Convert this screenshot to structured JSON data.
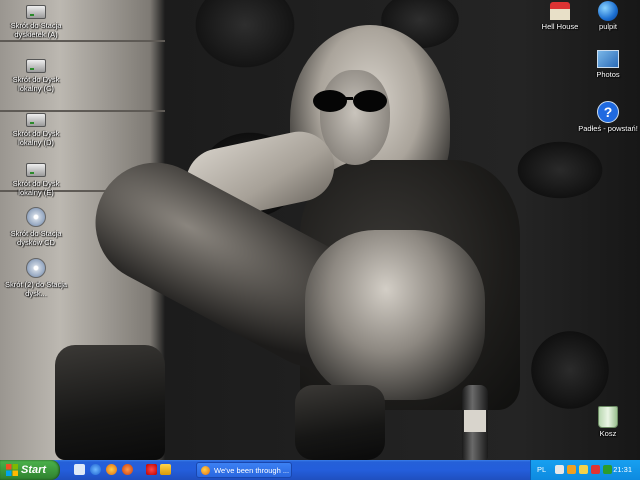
{
  "desktop": {
    "icons_left": [
      {
        "name": "icon-floppy-shortcut",
        "label": "Skrót do Stacja dyskietek (A)",
        "type": "drive"
      },
      {
        "name": "icon-disk-c-shortcut",
        "label": "Skrót do Dysk lokalny (C)",
        "type": "drive"
      },
      {
        "name": "icon-disk-d-shortcut",
        "label": "Skrót do Dysk lokalny (D)",
        "type": "drive"
      },
      {
        "name": "icon-disk-e-shortcut",
        "label": "Skrót do Dysk lokalny (E)",
        "type": "drive"
      },
      {
        "name": "icon-cd-drive-shortcut",
        "label": "Skrót do Stacja dysków CD",
        "type": "cd"
      },
      {
        "name": "icon-cd-drive-2-shortcut",
        "label": "Skrót (2) do Stacja dysk...",
        "type": "cd"
      }
    ],
    "icons_right": [
      {
        "name": "icon-hell-house",
        "label": "Hell House",
        "type": "hellhouse"
      },
      {
        "name": "icon-pulpit",
        "label": "pulpit",
        "type": "pulpit"
      },
      {
        "name": "icon-photos",
        "label": "Photos",
        "type": "photos"
      },
      {
        "name": "icon-padles-powstan",
        "label": "Padłeś - powstań!",
        "type": "help"
      },
      {
        "name": "icon-recycle-bin",
        "label": "Kosz",
        "type": "bin"
      }
    ],
    "help_glyph": "?"
  },
  "taskbar": {
    "start_label": "Start",
    "window_button": "We've been through ...",
    "language": "PL",
    "clock": "21:31"
  },
  "colors": {
    "taskbar_blue": "#245edb",
    "start_green": "#3d9a3d",
    "tray_blue": "#0d8ae0"
  }
}
